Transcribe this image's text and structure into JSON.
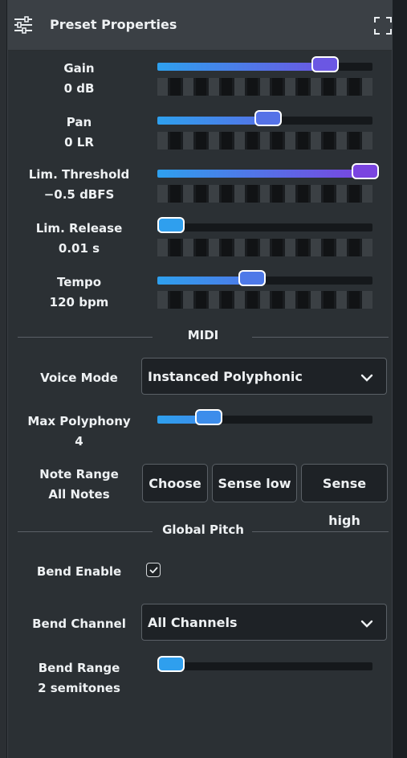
{
  "header": {
    "title": "Preset Properties",
    "settings_icon": "sliders-icon",
    "expand_icon": "fullscreen-icon"
  },
  "controls": [
    {
      "label": "Gain",
      "value": "0 dB",
      "level": 0.79
    },
    {
      "label": "Pan",
      "value": "0 LR",
      "level": 0.5
    },
    {
      "label": "Lim. Threshold",
      "value": "−0.5 dBFS",
      "level": 0.99
    },
    {
      "label": "Lim. Release",
      "value": "0.01 s",
      "level": 0.01
    },
    {
      "label": "Tempo",
      "value": "120 bpm",
      "level": 0.42
    }
  ],
  "midi": {
    "section_title": "MIDI",
    "voice_mode": {
      "label": "Voice Mode",
      "value": "Instanced Polyphonic"
    },
    "max_polyphony": {
      "label": "Max Polyphony",
      "value": "4",
      "level": 0.2
    },
    "note_range": {
      "label": "Note Range",
      "value": "All Notes",
      "buttons": [
        "Choose",
        "Sense low",
        "Sense high"
      ]
    }
  },
  "global_pitch": {
    "section_title": "Global Pitch",
    "bend_enable": {
      "label": "Bend Enable",
      "checked": true
    },
    "bend_channel": {
      "label": "Bend Channel",
      "value": "All Channels"
    },
    "bend_range": {
      "label": "Bend Range",
      "value": "2 semitones",
      "level": 0.01
    }
  },
  "colors": {
    "accent_start": "#2ea0ee",
    "accent_end": "#7b43e0",
    "panel_bg": "#2b3034",
    "titlebar_bg": "#3b4045"
  }
}
